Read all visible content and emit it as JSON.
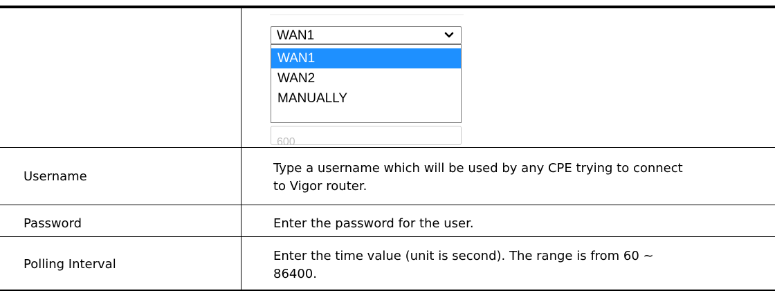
{
  "screenshot": {
    "dropdown": {
      "current_value": "WAN1",
      "options": [
        "WAN1",
        "WAN2",
        "MANUALLY"
      ],
      "highlighted_option": "WAN1",
      "chevron_icon": "chevron-down-icon"
    },
    "interval_input_value": "600"
  },
  "rows": [
    {
      "label": "Username",
      "description": "Type a username which will be used by any CPE trying to connect to Vigor router."
    },
    {
      "label": "Password",
      "description": "Enter the password for the user."
    },
    {
      "label": "Polling Interval",
      "description": "Enter the time value (unit is second). The range is from 60 ~ 86400."
    }
  ],
  "colors": {
    "highlight": "#1e90ff",
    "rule": "#000000"
  }
}
